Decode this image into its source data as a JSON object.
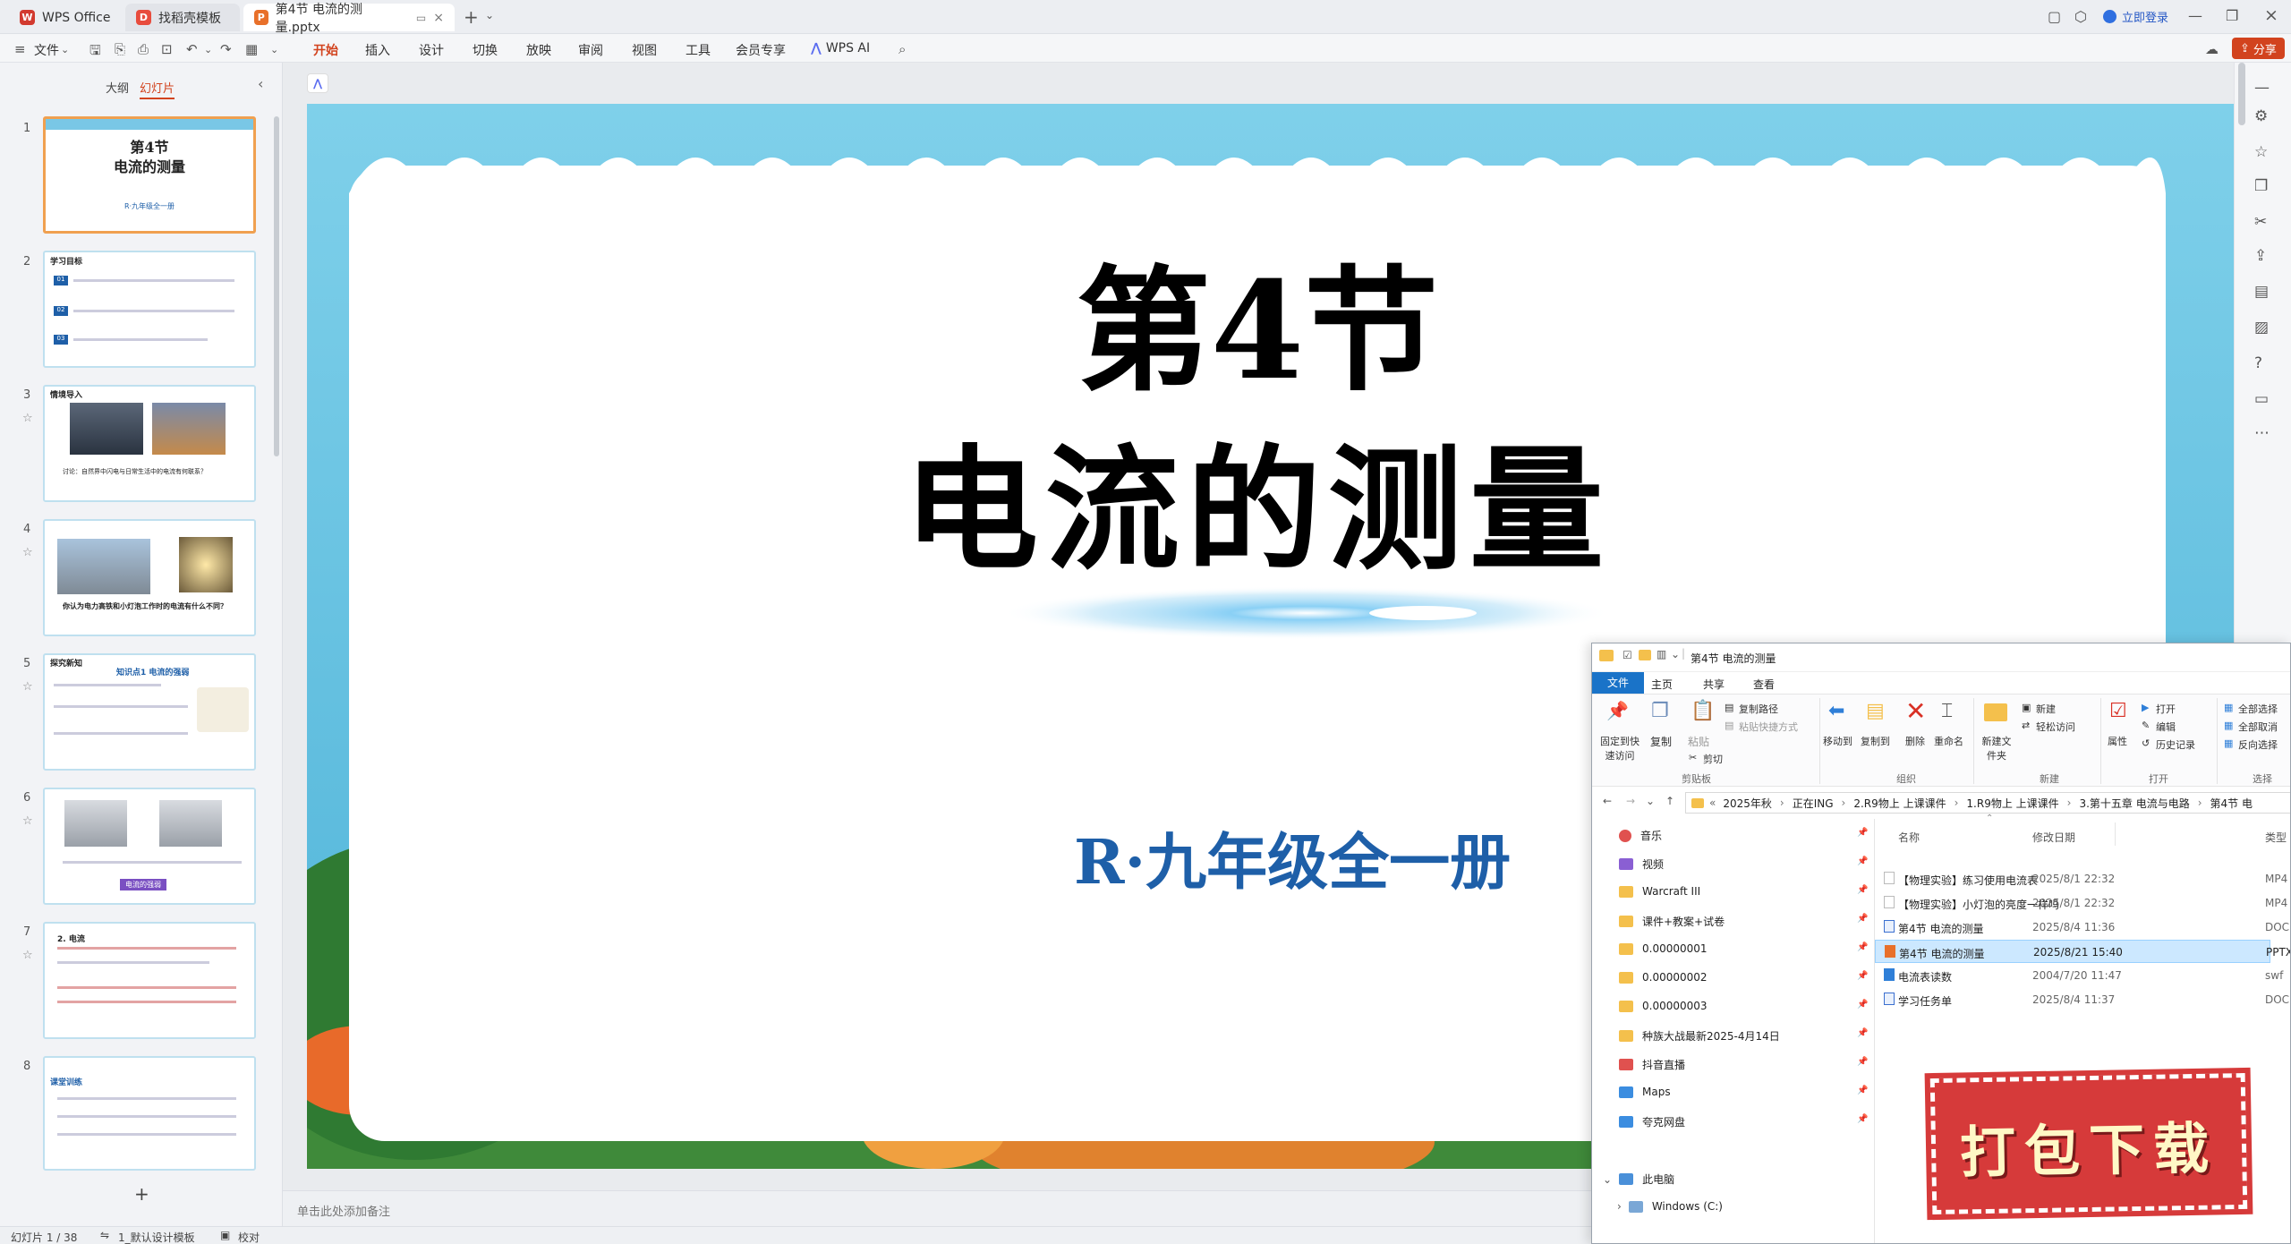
{
  "titlebar": {
    "tabs": [
      {
        "label": "WPS Office",
        "icon": "wps-logo-icon"
      },
      {
        "label": "找稻壳模板",
        "icon": "docer-icon"
      },
      {
        "label": "第4节 电流的测量.pptx",
        "icon": "pptx-file-icon"
      }
    ],
    "login": "立即登录"
  },
  "menubar": {
    "file": "文件",
    "items": [
      "开始",
      "插入",
      "设计",
      "切换",
      "放映",
      "审阅",
      "视图",
      "工具",
      "会员专享"
    ],
    "active": "开始",
    "ai": "WPS AI",
    "share": "分享"
  },
  "leftpanel": {
    "tab_outline": "大纲",
    "tab_slides": "幻灯片",
    "slides": [
      {
        "num": "1",
        "title": "第4节",
        "subtitle": "电流的测量",
        "footer": "R·九年级全一册"
      },
      {
        "num": "2",
        "header": "学习目标",
        "items": [
          "01",
          "02",
          "03"
        ]
      },
      {
        "num": "3",
        "header": "情境导入",
        "caption": "讨论：自然界中闪电与日常生活中的电流有何联系？"
      },
      {
        "num": "4",
        "caption": "你认为电力高铁和小灯泡工作时的电流有什么不同？"
      },
      {
        "num": "5",
        "header": "探究新知",
        "sub": "知识点1 电流的强弱"
      },
      {
        "num": "6",
        "caption": "电流的强弱"
      },
      {
        "num": "7",
        "text": "2. 电流"
      },
      {
        "num": "8",
        "header": "课堂训练"
      }
    ]
  },
  "slide": {
    "title_line1": "第4节",
    "title_line2": "电流的测量",
    "subtitle": "R·九年级全一册"
  },
  "notes": {
    "placeholder": "单击此处添加备注"
  },
  "statusbar": {
    "slide_count": "幻灯片 1 / 38",
    "theme": "1_默认设计模板",
    "proof": "校对"
  },
  "explorer": {
    "title": "第4节 电流的测量",
    "ribbon_tabs": [
      "文件",
      "主页",
      "共享",
      "查看"
    ],
    "ribbon": {
      "pin": "固定到快速访问",
      "copy": "复制",
      "paste": "粘贴",
      "copy_path": "复制路径",
      "paste_shortcut": "粘贴快捷方式",
      "cut": "剪切",
      "move_to": "移动到",
      "copy_to": "复制到",
      "delete": "删除",
      "rename": "重命名",
      "new_folder": "新建文件夹",
      "new_item": "新建",
      "easy_access": "轻松访问",
      "properties": "属性",
      "open": "打开",
      "edit": "编辑",
      "history": "历史记录",
      "select_all": "全部选择",
      "select_none": "全部取消",
      "invert": "反向选择",
      "groups": [
        "剪贴板",
        "组织",
        "新建",
        "打开",
        "选择"
      ]
    },
    "breadcrumb": [
      "2025年秋",
      "正在ING",
      "2.R9物上 上课课件",
      "1.R9物上 上课课件",
      "3.第十五章 电流与电路",
      "第4节 电"
    ],
    "nav": [
      {
        "label": "音乐",
        "color": "#e0514f"
      },
      {
        "label": "视频",
        "color": "#8a5fd3"
      },
      {
        "label": "Warcraft III",
        "color": "#f4c04c"
      },
      {
        "label": "课件+教案+试卷",
        "color": "#f4c04c"
      },
      {
        "label": "0.00000001",
        "color": "#f4c04c"
      },
      {
        "label": "0.00000002",
        "color": "#f4c04c"
      },
      {
        "label": "0.00000003",
        "color": "#f4c04c"
      },
      {
        "label": "种族大战最新2025-4月14日",
        "color": "#f4c04c"
      },
      {
        "label": "抖音直播",
        "color": "#e0514f"
      },
      {
        "label": "Maps",
        "color": "#3b8de0"
      },
      {
        "label": "夸克网盘",
        "color": "#3b8de0"
      }
    ],
    "this_pc": "此电脑",
    "drive": "Windows (C:)",
    "columns": {
      "name": "名称",
      "date": "修改日期",
      "type": "类型"
    },
    "files": [
      {
        "name": "【物理实验】练习使用电流表",
        "date": "2025/8/1 22:32",
        "type": "MP4",
        "selected": false
      },
      {
        "name": "【物理实验】小灯泡的亮度一样吗",
        "date": "2025/8/1 22:32",
        "type": "MP4",
        "selected": false
      },
      {
        "name": "第4节 电流的测量",
        "date": "2025/8/4 11:36",
        "type": "DOC",
        "selected": false
      },
      {
        "name": "第4节 电流的测量",
        "date": "2025/8/21 15:40",
        "type": "PPTX",
        "selected": true
      },
      {
        "name": "电流表读数",
        "date": "2004/7/20 11:47",
        "type": "swf",
        "selected": false
      },
      {
        "name": "学习任务单",
        "date": "2025/8/4 11:37",
        "type": "DOC",
        "selected": false
      }
    ]
  },
  "download_badge": "打包下载",
  "colors": {
    "accent": "#d2431e",
    "slide_subtitle": "#1e5fa8",
    "badge": "#d63a3a"
  }
}
